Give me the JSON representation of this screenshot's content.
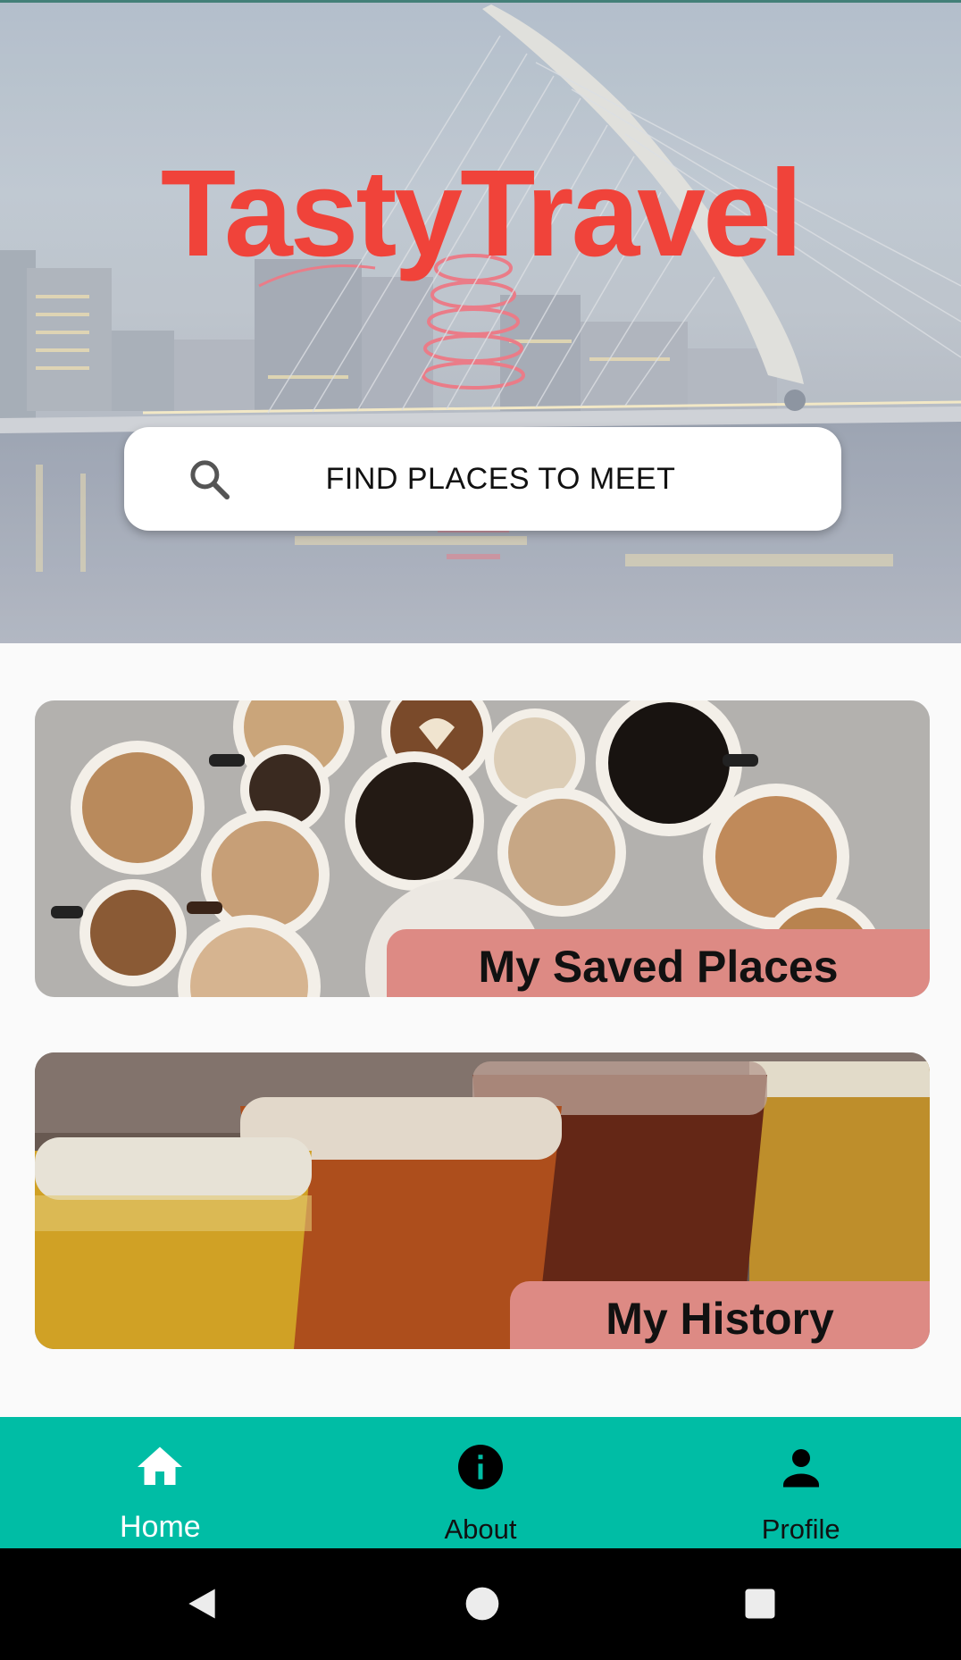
{
  "app": {
    "title": "TastyTravel"
  },
  "search": {
    "label": "FIND PLACES TO MEET",
    "icon": "search-icon"
  },
  "cards": [
    {
      "label": "My Saved Places",
      "image": "coffee-cups-image"
    },
    {
      "label": "My History",
      "image": "beer-glasses-image"
    }
  ],
  "bottom_nav": {
    "items": [
      {
        "label": "Home",
        "icon": "home-icon",
        "active": true
      },
      {
        "label": "About",
        "icon": "info-icon",
        "active": false
      },
      {
        "label": "Profile",
        "icon": "person-icon",
        "active": false
      }
    ]
  },
  "system_nav": {
    "buttons": [
      "back-icon",
      "home-circle-icon",
      "recents-icon"
    ]
  },
  "colors": {
    "accent": "#00bda5",
    "title_red": "#f0433a",
    "card_label_bg": "#dd8a84",
    "background": "#fafafa"
  }
}
